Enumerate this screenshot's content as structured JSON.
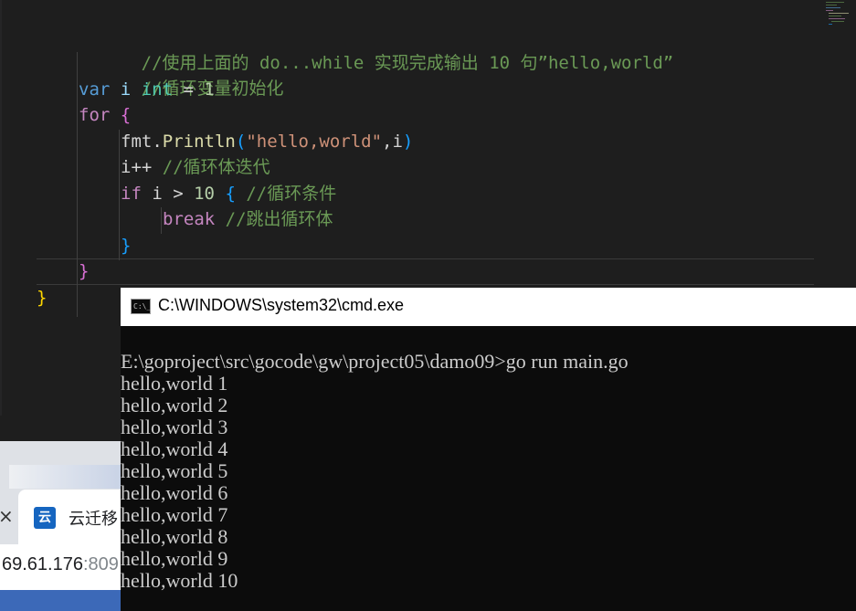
{
  "editor": {
    "lines": [
      {
        "comment": "//使用上面的 do...while 实现完成输出 10 句”hello,world”"
      },
      {
        "comment": "//循环变量初始化"
      },
      {
        "kw_var": "var",
        "ident": "i",
        "kw_type": "int",
        "op": "=",
        "value": "1"
      },
      {
        "kw_for": "for",
        "brace": "{"
      },
      {
        "pkg": "fmt",
        "dot": ".",
        "func": "Println",
        "lparen": "(",
        "str": "\"hello,world\"",
        "args": ",i",
        "rparen": ")"
      },
      {
        "code": "i++",
        "comment": "//循环体迭代"
      },
      {
        "kw_if": "if",
        "cond": "i > ",
        "value": "10",
        "brace": "{",
        "comment": "//循环条件"
      },
      {
        "kw_break": "break",
        "comment": "//跳出循环体"
      },
      {
        "brace": "}"
      },
      {
        "brace": "}"
      },
      {
        "brace": "}"
      }
    ],
    "colors": {
      "background": "#1e1e1e",
      "comment": "#6a9955",
      "keyword": "#569cd6",
      "control": "#c586c0",
      "number": "#b5cea8",
      "string": "#ce9178",
      "function": "#dcdcaa"
    }
  },
  "browser": {
    "tab_close_icon": "×",
    "favicon_text": "云",
    "tab_title": "云迁移",
    "url_host": "69.61.176",
    "url_port": ":809"
  },
  "cmd": {
    "title": "C:\\WINDOWS\\system32\\cmd.exe",
    "icon_text": "C:\\_",
    "prompt": "E:\\goproject\\src\\gocode\\gw\\project05\\damo09>",
    "command": "go run main.go",
    "output": [
      "hello,world 1",
      "hello,world 2",
      "hello,world 3",
      "hello,world 4",
      "hello,world 5",
      "hello,world 6",
      "hello,world 7",
      "hello,world 8",
      "hello,world 9",
      "hello,world 10"
    ],
    "colors": {
      "background": "#0c0c0c",
      "text": "#cccccc"
    }
  }
}
